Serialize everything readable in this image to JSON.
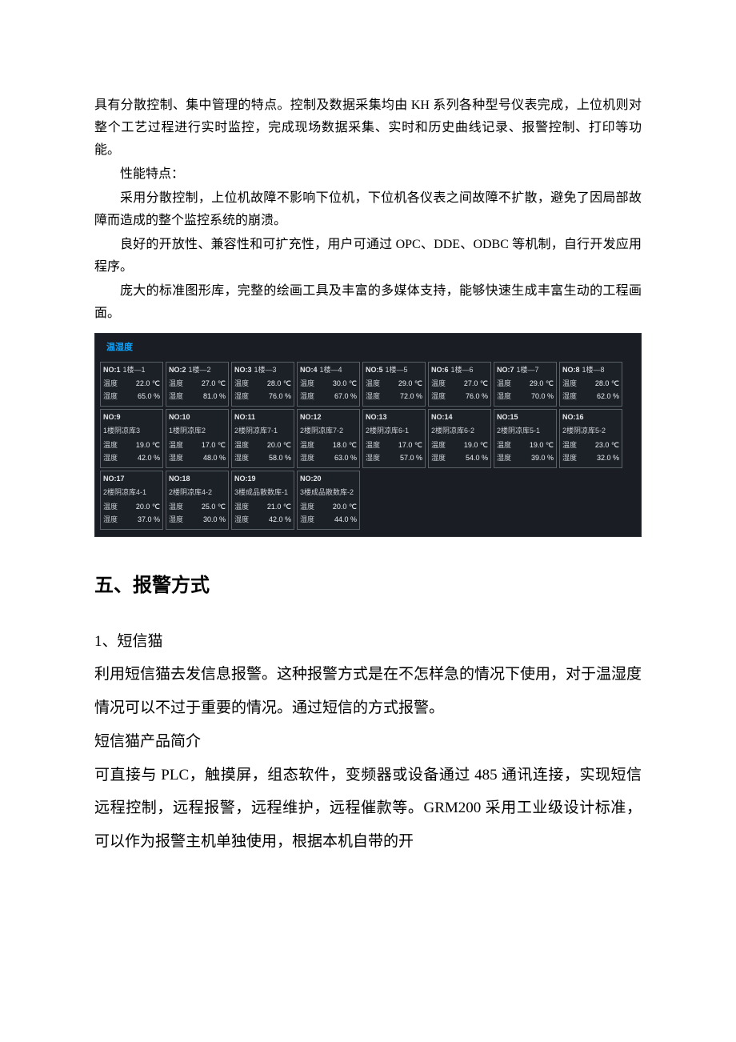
{
  "para": {
    "p1": "具有分散控制、集中管理的特点。控制及数据采集均由 KH 系列各种型号仪表完成，上位机则对整个工艺过程进行实时监控，完成现场数据采集、实时和历史曲线记录、报警控制、打印等功能。",
    "p2": "性能特点：",
    "p3": "采用分散控制，上位机故障不影响下位机，下位机各仪表之间故障不扩散，避免了因局部故障而造成的整个监控系统的崩溃。",
    "p4": "良好的开放性、兼容性和可扩充性，用户可通过 OPC、DDE、ODBC 等机制，自行开发应用程序。",
    "p5": "庞大的标准图形库，完整的绘画工具及丰富的多媒体支持，能够快速生成丰富生动的工程画面。"
  },
  "panel": {
    "title": "温湿度",
    "t_label": "温度",
    "h_label": "湿度",
    "tiles": [
      {
        "no": "NO:1",
        "loc": "1楼—1",
        "t": "22.0 ℃",
        "h": "65.0 %"
      },
      {
        "no": "NO:2",
        "loc": "1楼—2",
        "t": "27.0 ℃",
        "h": "81.0 %"
      },
      {
        "no": "NO:3",
        "loc": "1楼—3",
        "t": "28.0 ℃",
        "h": "76.0 %"
      },
      {
        "no": "NO:4",
        "loc": "1楼—4",
        "t": "30.0 ℃",
        "h": "67.0 %"
      },
      {
        "no": "NO:5",
        "loc": "1楼—5",
        "t": "29.0 ℃",
        "h": "72.0 %"
      },
      {
        "no": "NO:6",
        "loc": "1楼—6",
        "t": "27.0 ℃",
        "h": "76.0 %"
      },
      {
        "no": "NO:7",
        "loc": "1楼—7",
        "t": "29.0 ℃",
        "h": "70.0 %"
      },
      {
        "no": "NO:8",
        "loc": "1楼—8",
        "t": "28.0 ℃",
        "h": "62.0 %"
      },
      {
        "no": "NO:9",
        "loc": "1楼阴凉库3",
        "t": "19.0 ℃",
        "h": "42.0 %"
      },
      {
        "no": "NO:10",
        "loc": "1楼阴凉库2",
        "t": "17.0 ℃",
        "h": "48.0 %"
      },
      {
        "no": "NO:11",
        "loc": "2楼阴凉库7-1",
        "t": "20.0 ℃",
        "h": "58.0 %"
      },
      {
        "no": "NO:12",
        "loc": "2楼阴凉库7-2",
        "t": "18.0 ℃",
        "h": "63.0 %"
      },
      {
        "no": "NO:13",
        "loc": "2楼阴凉库6-1",
        "t": "17.0 ℃",
        "h": "57.0 %"
      },
      {
        "no": "NO:14",
        "loc": "2楼阴凉库6-2",
        "t": "19.0 ℃",
        "h": "54.0 %"
      },
      {
        "no": "NO:15",
        "loc": "2楼阴凉库5-1",
        "t": "19.0 ℃",
        "h": "39.0 %"
      },
      {
        "no": "NO:16",
        "loc": "2楼阴凉库5-2",
        "t": "23.0 ℃",
        "h": "32.0 %"
      },
      {
        "no": "NO:17",
        "loc": "2楼阴凉库4-1",
        "t": "20.0 ℃",
        "h": "37.0 %"
      },
      {
        "no": "NO:18",
        "loc": "2楼阴凉库4-2",
        "t": "25.0 ℃",
        "h": "30.0 %"
      },
      {
        "no": "NO:19",
        "loc": "3楼成品散数库-1",
        "t": "21.0 ℃",
        "h": "42.0 %"
      },
      {
        "no": "NO:20",
        "loc": "3楼成品散数库-2",
        "t": "20.0 ℃",
        "h": "44.0 %"
      }
    ]
  },
  "section5": {
    "heading": "五、报警方式",
    "p1": "1、短信猫",
    "p2": "利用短信猫去发信息报警。这种报警方式是在不怎样急的情况下使用，对于温湿度情况可以不过于重要的情况。通过短信的方式报警。",
    "p3": "短信猫产品简介",
    "p4": "可直接与 PLC，触摸屏，组态软件，变频器或设备通过 485 通讯连接，实现短信远程控制，远程报警，远程维护，远程催款等。GRM200 采用工业级设计标准，可以作为报警主机单独使用，根据本机自带的开"
  }
}
